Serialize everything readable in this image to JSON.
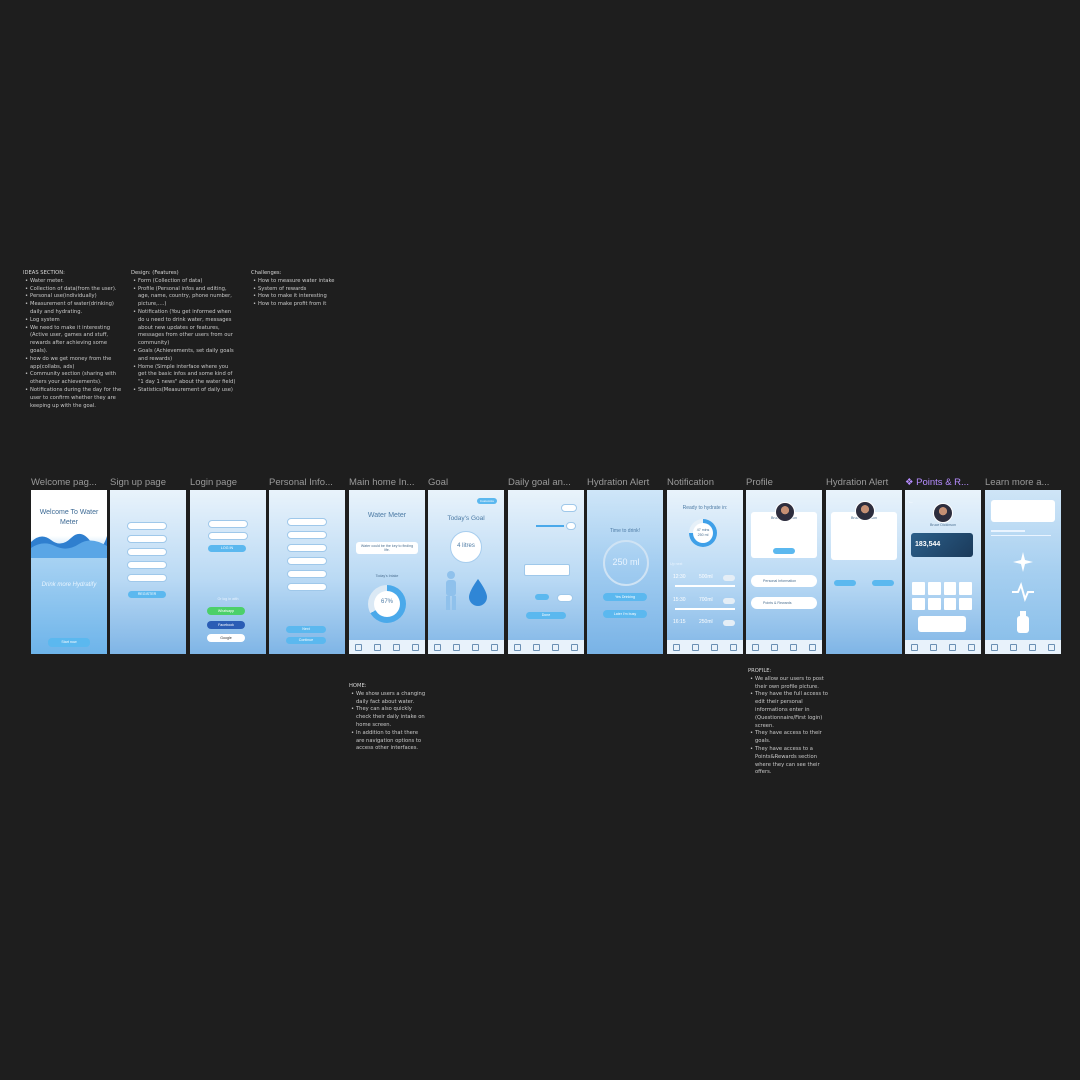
{
  "notes": {
    "ideas": {
      "title": "IDEAS SECTION:",
      "items": [
        "Water meter.",
        "Collection of data(from the user).",
        "Personal use(individually)",
        "Measurement of water(drinking) daily and hydrating.",
        "Log system",
        "We need to make it interesting (Active user, games and stuff, rewards after achieving some goals).",
        "how do we get money from the app(collabs, ads)",
        "Community section (sharing with others your achievements).",
        "Notifications during the day for the user to confirm whether they are keeping up with the goal."
      ]
    },
    "design": {
      "title": "Design: (Features)",
      "items": [
        "Form (Collection of data)",
        "Profile (Personal infos and editing, age, name, country, phone number, picture,....)",
        "Notification (You get informed when do u need to drink water, messages about new updates or features, messages from other users from our community)",
        "Goals (Achievements, set daily goals and rewards)",
        "Home (Simple interface where you get the basic infos and some kind of \"1 day 1 news\" about the water field)",
        "Statistics(Measurement of daily use)"
      ]
    },
    "challenges": {
      "title": "Challenges:",
      "items": [
        "How to measure water intake",
        "System of rewards",
        "How to make it interesting",
        "How to make profit from it"
      ]
    },
    "home": {
      "title": "HOME:",
      "items": [
        "We show users a changing daily fact about water.",
        "They can also quickly check their daily intake on home screen.",
        "In addition to that there are navigation options to access other interfaces."
      ]
    },
    "profile": {
      "title": "PROFILE:",
      "items": [
        "We allow our users to post their own profile picture.",
        "They have the full access to edit their personal informations enter in (Questionnaire/First login) screen.",
        "They have access to their goals.",
        "They have access to a Points&Rewards section where they can see their offers."
      ]
    }
  },
  "frames": [
    {
      "label": "Welcome pag..."
    },
    {
      "label": "Sign up page"
    },
    {
      "label": "Login page"
    },
    {
      "label": "Personal Info..."
    },
    {
      "label": "Main home In..."
    },
    {
      "label": "Goal"
    },
    {
      "label": "Daily goal an..."
    },
    {
      "label": "Hydration Alert"
    },
    {
      "label": "Notification"
    },
    {
      "label": "Profile"
    },
    {
      "label": "Hydration Alert"
    },
    {
      "label": "❖ Points & R..."
    },
    {
      "label": "Learn more a..."
    }
  ],
  "screens": {
    "welcome": {
      "title": "Welcome To Water Meter",
      "tagline": "Drink more Hydratify",
      "button": "Start now"
    },
    "signup": {
      "button": "REGISTER"
    },
    "login": {
      "button": "LOG IN",
      "or": "Or log in with",
      "socials": [
        "Whatsapp",
        "Facebook",
        "Google"
      ]
    },
    "personal": {
      "buttons": [
        "Next",
        "Continue"
      ]
    },
    "home": {
      "title": "Water Meter",
      "fact": "Water could be the key to finding life.",
      "subtitle": "Today's Intake",
      "percent": "67%"
    },
    "goal": {
      "title": "Today's Goal",
      "amount": "4 litres",
      "chip": "Customize"
    },
    "daily": {
      "button": "Done"
    },
    "alert": {
      "title": "Time to drink!",
      "amount": "250 ml",
      "buttons": [
        "Yes Drinking",
        "Later I'm busy"
      ]
    },
    "notification": {
      "title": "Ready to hydrate in:",
      "timer": "47 mins",
      "ml": "250 ml",
      "section": "Up next",
      "rows": [
        {
          "time": "12:30",
          "amount": "500ml"
        },
        {
          "time": "15:30",
          "amount": "700ml"
        },
        {
          "time": "16:15",
          "amount": "250ml"
        }
      ]
    },
    "profile": {
      "name": "Bruce Dickinson",
      "items": [
        "Personal Information",
        "Points & Rewards"
      ]
    },
    "alert2": {
      "name": "Bruce Dickinson"
    },
    "points": {
      "name": "Bruce Dickinson",
      "points": "183,544"
    }
  }
}
